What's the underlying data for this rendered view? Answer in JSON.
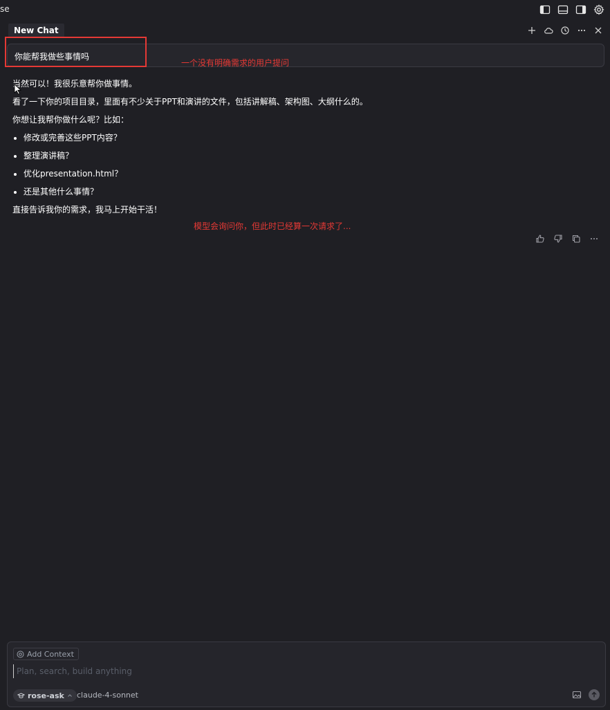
{
  "app": {
    "title": "se"
  },
  "tab": {
    "title": "New Chat"
  },
  "user_message": {
    "text": "你能帮我做些事情吗"
  },
  "annotations": {
    "user_question": "一个没有明确需求的用户提问",
    "model_reply": "模型会询问你，但此时已经算一次请求了..."
  },
  "assistant": {
    "line1": "当然可以！我很乐意帮你做事情。",
    "line2": "看了一下你的项目目录，里面有不少关于PPT和演讲的文件，包括讲解稿、架构图、大纲什么的。",
    "line3": "你想让我帮你做什么呢？比如：",
    "bullets": [
      "修改或完善这些PPT内容？",
      "整理演讲稿？",
      "优化presentation.html？",
      "还是其他什么事情？"
    ],
    "line4": "直接告诉我你的需求，我马上开始干活！"
  },
  "composer": {
    "add_context_label": "Add Context",
    "input_placeholder": "Plan, search, build anything",
    "mode_label": "rose-ask",
    "model_label": "claude-4-sonnet"
  },
  "icons": {
    "top_right": [
      "sidebar-left-icon",
      "panel-bottom-icon",
      "sidebar-right-icon",
      "gear-icon"
    ],
    "tab_actions": [
      "plus-icon",
      "cloud-icon",
      "history-icon",
      "more-icon",
      "close-icon"
    ],
    "feedback": [
      "thumbs-up-icon",
      "thumbs-down-icon",
      "copy-icon",
      "more-icon"
    ]
  },
  "colors": {
    "background": "#1f1f24",
    "annotation_red": "#e53935",
    "text": "#ffffff"
  }
}
